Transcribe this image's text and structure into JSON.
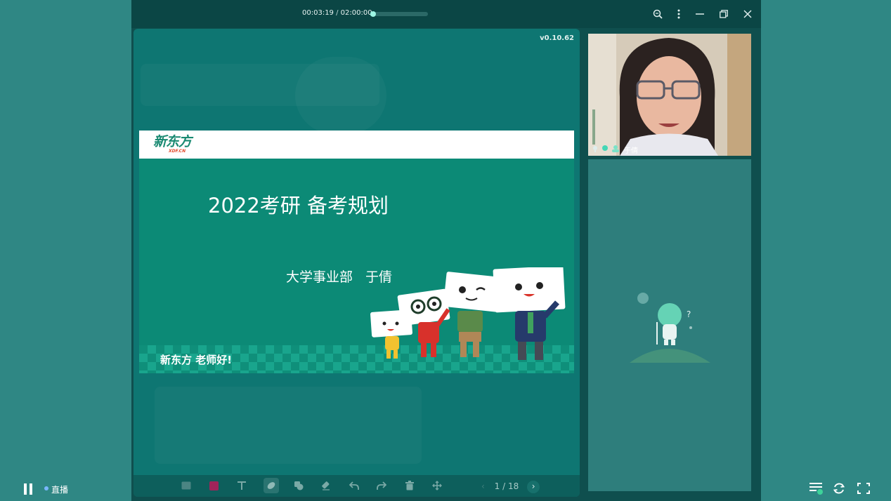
{
  "player": {
    "time_current": "00:03:19",
    "time_separator": "/",
    "time_total": "02:00:00",
    "progress_fraction": 0.028
  },
  "stage": {
    "version": "v0.10.62"
  },
  "slide": {
    "logo_brand": "新东方",
    "logo_domain": "XDF.CN",
    "title": "2022考研 备考规划",
    "subtitle": "大学事业部 于倩",
    "slogan": "新东方 老师好!"
  },
  "toolbar": {
    "page_current": "1",
    "page_separator": "/",
    "page_total": "18",
    "tools": [
      "image-icon",
      "color-swatch",
      "text-icon",
      "pen-icon",
      "shape-icon",
      "eraser-icon",
      "undo-icon",
      "redo-icon",
      "trash-icon",
      "move-icon"
    ],
    "swatch_color": "#a0245a"
  },
  "video": {
    "name": "于倩"
  },
  "bottom": {
    "live_label": "直播"
  },
  "colors": {
    "accent": "#59d6c1",
    "slide_bg": "#0c8a76",
    "page_bg": "#2e7f7c"
  }
}
